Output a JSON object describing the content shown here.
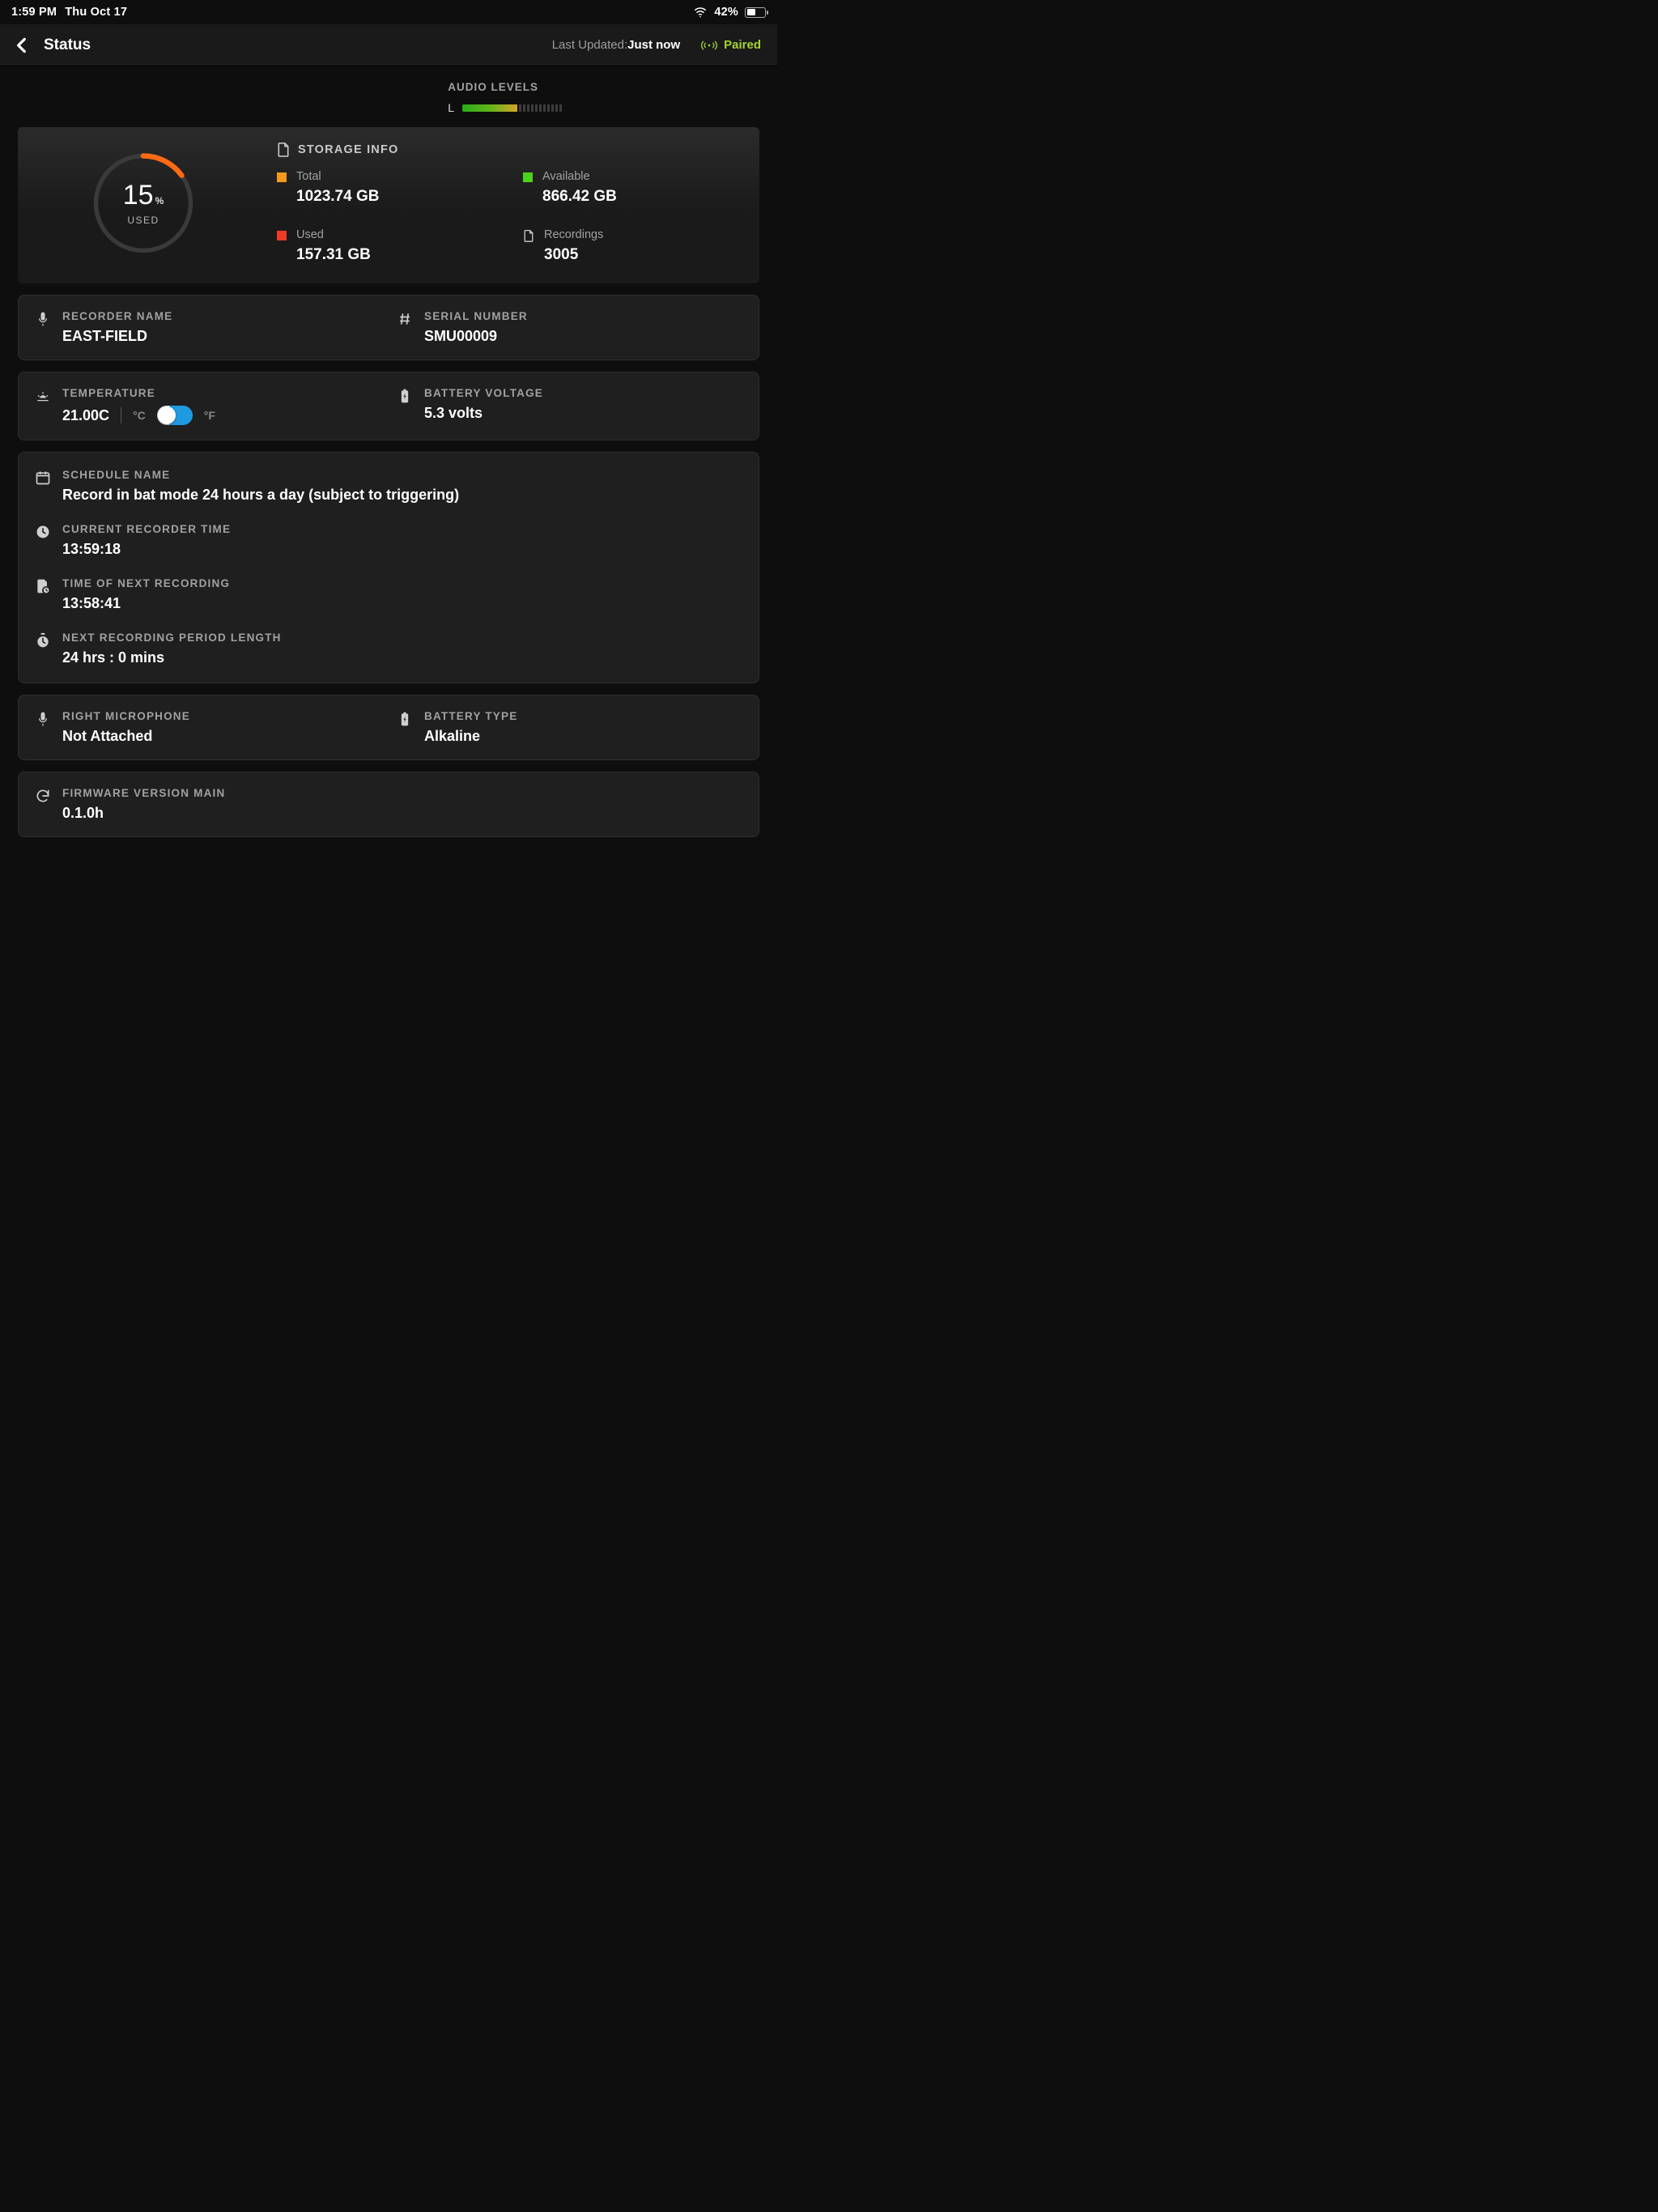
{
  "statusbar": {
    "time": "1:59 PM",
    "date": "Thu Oct 17",
    "battery_pct_text": "42%",
    "battery_fill_pct": 42
  },
  "header": {
    "title": "Status",
    "last_updated_label": "Last Updated:",
    "last_updated_value": "Just now",
    "paired_text": "Paired"
  },
  "audio": {
    "title": "AUDIO LEVELS",
    "channel": "L",
    "level_pct": 55
  },
  "storage": {
    "heading": "STORAGE INFO",
    "used_pct": 15,
    "used_label": "USED",
    "total_label": "Total",
    "total_value": "1023.74 GB",
    "available_label": "Available",
    "available_value": "866.42 GB",
    "used_bytes_label": "Used",
    "used_bytes_value": "157.31 GB",
    "recordings_label": "Recordings",
    "recordings_value": "3005",
    "colors": {
      "total": "#f39a1c",
      "available": "#4cd21b",
      "used": "#f03a25"
    }
  },
  "recorder": {
    "name_label": "RECORDER NAME",
    "name_value": "EAST-FIELD",
    "serial_label": "SERIAL NUMBER",
    "serial_value": "SMU00009"
  },
  "env": {
    "temp_label": "TEMPERATURE",
    "temp_value": "21.00C",
    "temp_unit_c": "°C",
    "temp_unit_f": "°F",
    "voltage_label": "BATTERY VOLTAGE",
    "voltage_value": "5.3 volts"
  },
  "schedule": {
    "name_label": "SCHEDULE NAME",
    "name_value": "Record in bat mode 24 hours a day (subject to triggering)",
    "time_label": "CURRENT RECORDER TIME",
    "time_value": "13:59:18",
    "next_label": "TIME OF NEXT RECORDING",
    "next_value": "13:58:41",
    "period_label": "NEXT RECORDING PERIOD LENGTH",
    "period_value": "24 hrs : 0 mins"
  },
  "mic": {
    "right_label": "RIGHT MICROPHONE",
    "right_value": "Not Attached",
    "batt_type_label": "BATTERY TYPE",
    "batt_type_value": "Alkaline"
  },
  "firmware": {
    "label": "FIRMWARE VERSION MAIN",
    "value": "0.1.0h"
  }
}
